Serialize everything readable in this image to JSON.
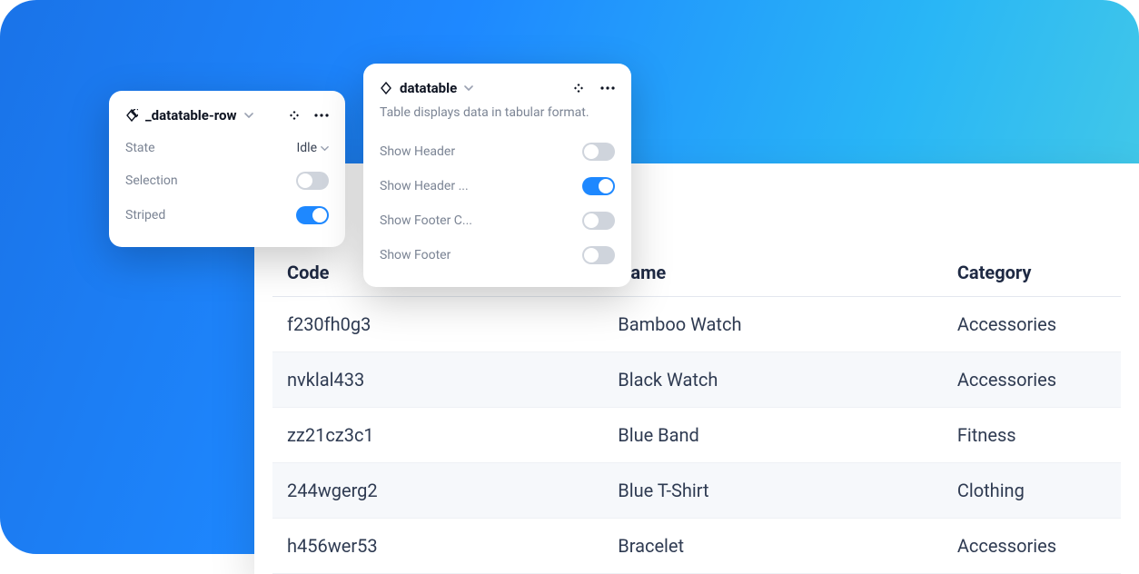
{
  "panels": {
    "row": {
      "title": "_datatable-row",
      "props": [
        {
          "label": "State",
          "kind": "dropdown",
          "value": "Idle"
        },
        {
          "label": "Selection",
          "kind": "toggle",
          "on": false
        },
        {
          "label": "Striped",
          "kind": "toggle",
          "on": true
        }
      ]
    },
    "table": {
      "title": "datatable",
      "description": "Table displays data in tabular format.",
      "props": [
        {
          "label": "Show Header",
          "kind": "toggle",
          "on": false
        },
        {
          "label": "Show Header ...",
          "kind": "toggle",
          "on": true
        },
        {
          "label": "Show Footer C...",
          "kind": "toggle",
          "on": false
        },
        {
          "label": "Show Footer",
          "kind": "toggle",
          "on": false
        }
      ]
    }
  },
  "table": {
    "columns": [
      "Code",
      "Name",
      "Category"
    ],
    "rows": [
      [
        "f230fh0g3",
        "Bamboo Watch",
        "Accessories"
      ],
      [
        "nvklal433",
        "Black Watch",
        "Accessories"
      ],
      [
        "zz21cz3c1",
        "Blue Band",
        "Fitness"
      ],
      [
        "244wgerg2",
        "Blue T-Shirt",
        "Clothing"
      ],
      [
        "h456wer53",
        "Bracelet",
        "Accessories"
      ]
    ]
  }
}
